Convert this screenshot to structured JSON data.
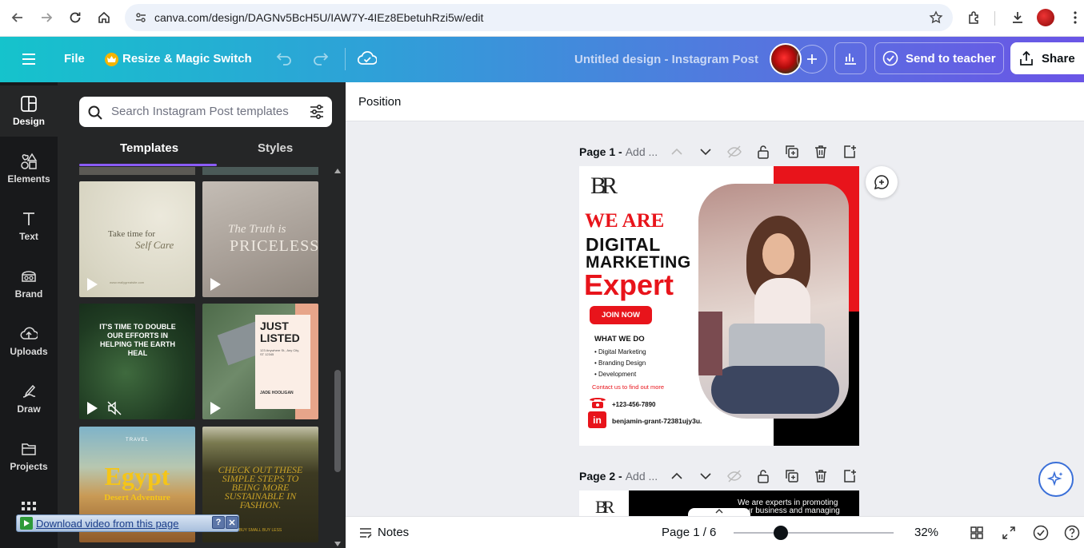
{
  "browser": {
    "url": "canva.com/design/DAGNv5BcH5U/IAW7Y-4IEz8EbetuhRzi5w/edit"
  },
  "header": {
    "file_label": "File",
    "resize_label": "Resize & Magic Switch",
    "design_title": "Untitled design - Instagram Post",
    "send_label": "Send to teacher",
    "share_label": "Share"
  },
  "rail": {
    "items": [
      {
        "label": "Design",
        "icon": "design-icon"
      },
      {
        "label": "Elements",
        "icon": "elements-icon"
      },
      {
        "label": "Text",
        "icon": "text-icon"
      },
      {
        "label": "Brand",
        "icon": "brand-icon"
      },
      {
        "label": "Uploads",
        "icon": "uploads-icon"
      },
      {
        "label": "Draw",
        "icon": "draw-icon"
      },
      {
        "label": "Projects",
        "icon": "projects-icon"
      }
    ]
  },
  "panel": {
    "search_placeholder": "Search Instagram Post templates",
    "tabs": [
      "Templates",
      "Styles"
    ],
    "templates": [
      {
        "line1": "Take time for",
        "line2": "Self Care",
        "footer": "www.reallygreatsite.com"
      },
      {
        "line1": "The Truth is",
        "line2": "PRICELESS"
      },
      {
        "line1": "IT'S TIME TO DOUBLE OUR EFFORTS IN HELPING THE EARTH HEAL"
      },
      {
        "line1": "JUST LISTED",
        "address": "123 Anywhere St., Any City, ST 12345",
        "agent": "JADE HOOLIGAN"
      },
      {
        "line1": "TRAVEL",
        "line2": "Egypt",
        "line3": "Desert Adventure"
      },
      {
        "line1": "CHECK OUT THESE SIMPLE STEPS TO BEING MORE SUSTAINABLE IN FASHION.",
        "footer": "BUY SMALL BUY LESS"
      }
    ],
    "download_bar": "Download video from this page"
  },
  "toolbar": {
    "position_label": "Position"
  },
  "pages": [
    {
      "label": "Page 1 - ",
      "title_placeholder": "Add ..."
    },
    {
      "label": "Page 2 - ",
      "title_placeholder": "Add ..."
    }
  ],
  "design": {
    "logo": "BR",
    "we_are": "WE ARE",
    "digital": "DIGITAL",
    "marketing": "MARKETING",
    "expert": "Expert",
    "join": "JOIN NOW",
    "what_we_do": "WHAT WE DO",
    "services": [
      "Digital Marketing",
      "Branding Design",
      "Development"
    ],
    "contact": "Contact us to find out more",
    "phone": "+123-456-7890",
    "linkedin": "benjamin-grant-72381ujy3u.",
    "page2_text1": "We are experts in promoting",
    "page2_text2": "your business and managing"
  },
  "bottom": {
    "notes_label": "Notes",
    "page_indicator": "Page 1 / 6",
    "zoom": "32%",
    "zoom_level": 0.32
  },
  "colors": {
    "accent_red": "#e8141b",
    "brand_gradient_start": "#15c3cc",
    "brand_gradient_end": "#6a55e6"
  }
}
